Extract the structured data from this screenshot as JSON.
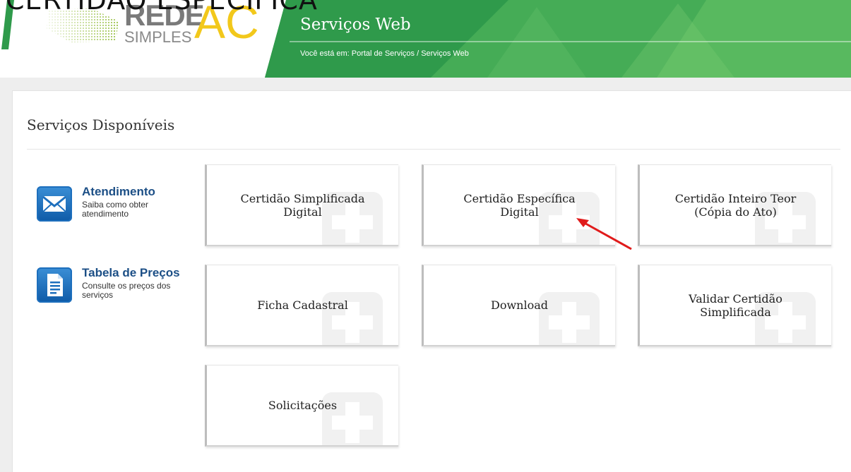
{
  "overlay_text": "CERTIDÃO ESPECÍFICA",
  "logo": {
    "rede": "REDE",
    "simples": "SIMPLES",
    "ac": "AC"
  },
  "banner": {
    "title": "Serviços Web",
    "breadcrumb": "Você está em: Portal de Serviços / Serviços Web"
  },
  "section_title": "Serviços Disponíveis",
  "side_items": [
    {
      "title": "Atendimento",
      "subtitle": "Saiba como obter atendimento",
      "icon": "envelope-icon"
    },
    {
      "title": "Tabela de Preços",
      "subtitle": "Consulte os preços dos serviços",
      "icon": "document-icon"
    }
  ],
  "cards": [
    {
      "label": "Certidão Simplificada Digital"
    },
    {
      "label": "Certidão Específica Digital"
    },
    {
      "label": "Certidão Inteiro Teor (Cópia do Ato)"
    },
    {
      "label": "Ficha Cadastral"
    },
    {
      "label": "Download"
    },
    {
      "label": "Validar Certidão Simplificada"
    },
    {
      "label": "Solicitações"
    }
  ],
  "colors": {
    "banner_green": "#2e9a4c",
    "banner_green_light": "#58b95e",
    "logo_yellow": "#f2c81b",
    "side_title": "#1c4f86",
    "annotation_arrow": "#e01b1b"
  }
}
